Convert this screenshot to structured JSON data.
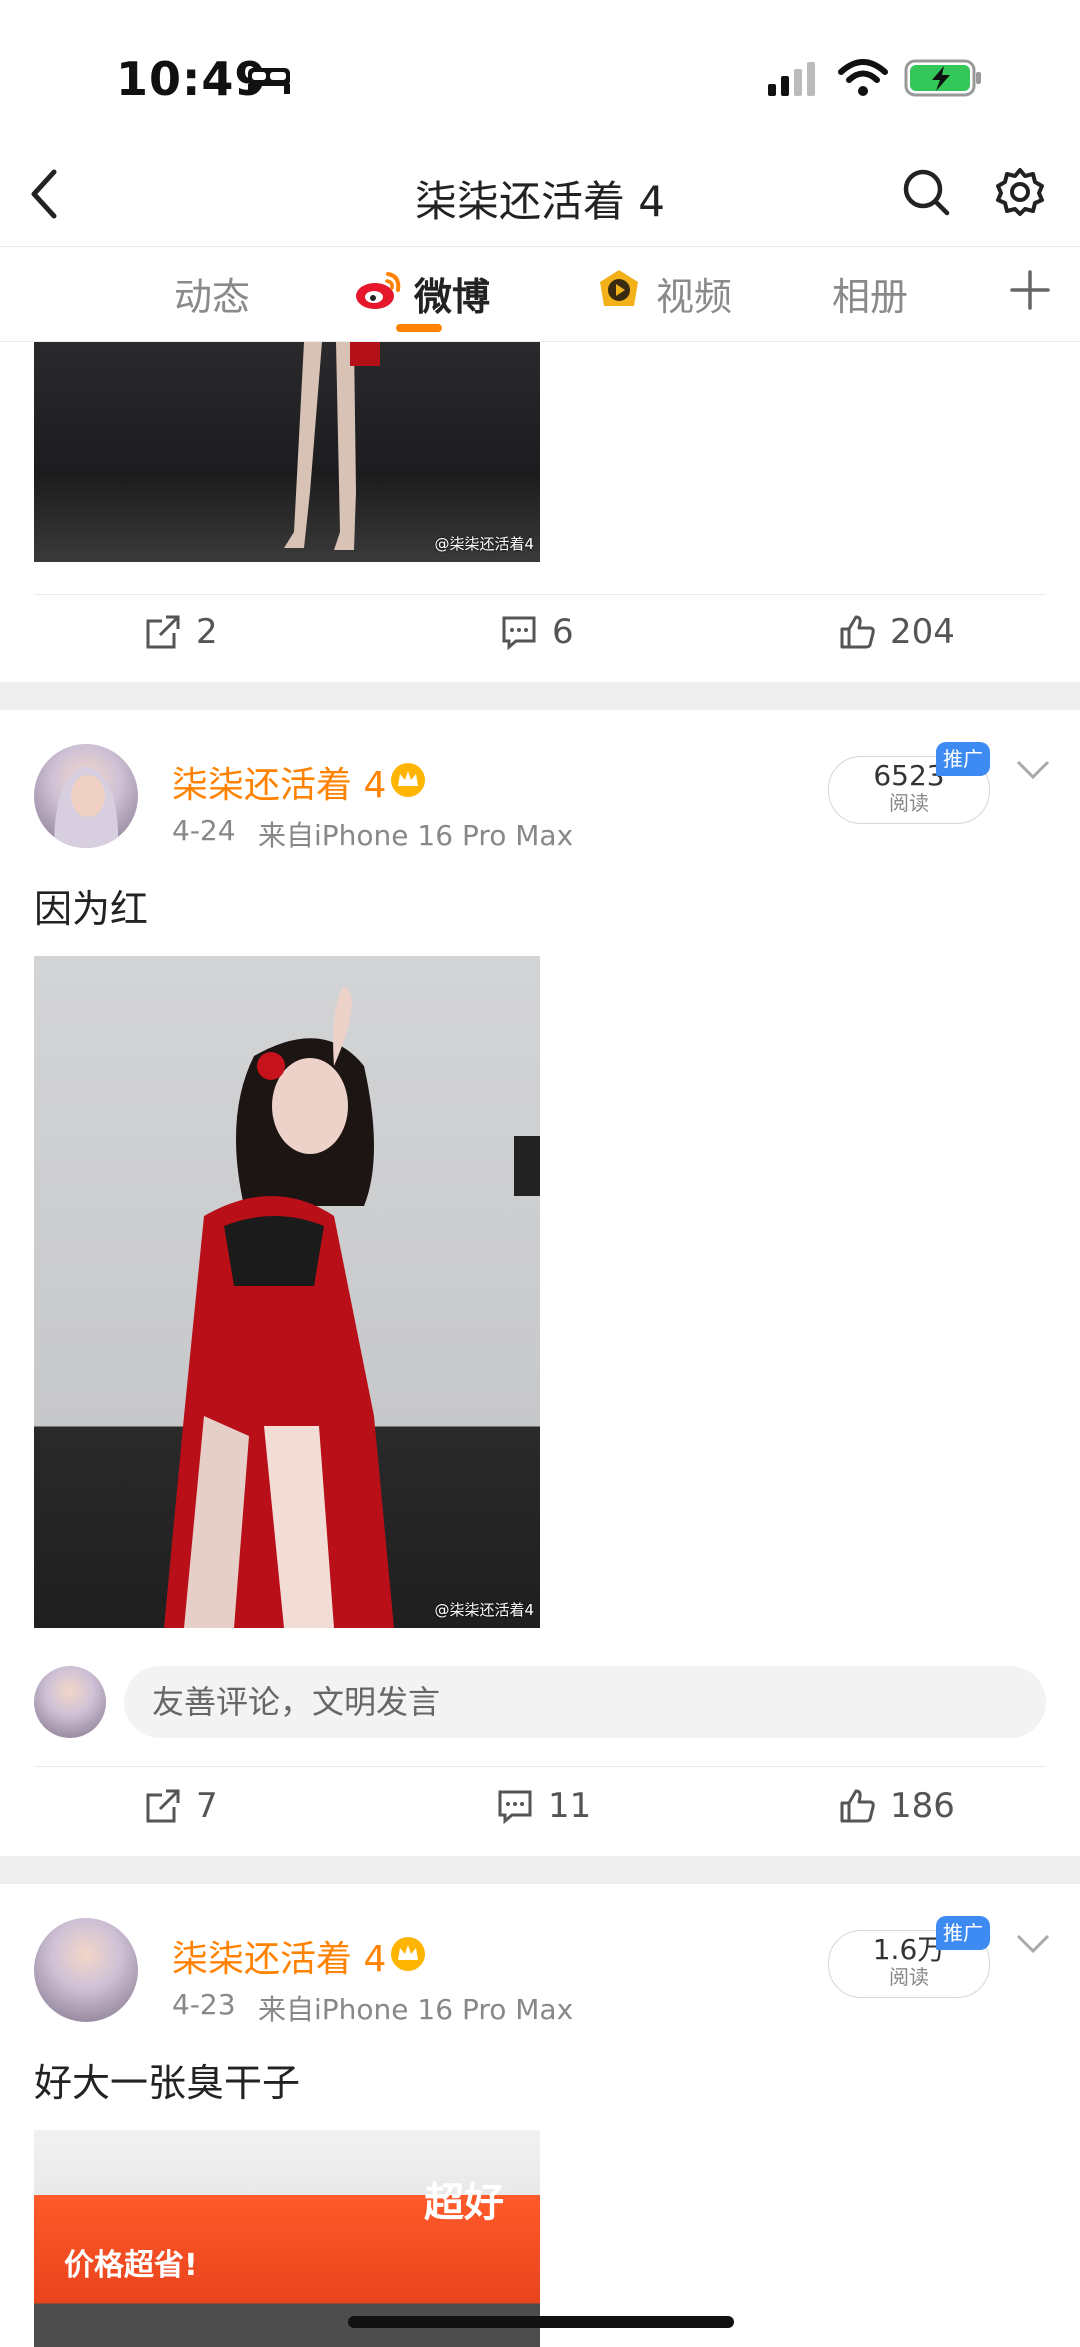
{
  "status_bar": {
    "time": "10:49"
  },
  "nav": {
    "title": "柒柒还活着 4"
  },
  "tabs": [
    {
      "label": "动态"
    },
    {
      "label": "微博"
    },
    {
      "label": "视频"
    },
    {
      "label": "相册"
    }
  ],
  "colors": {
    "accent": "#ff8200",
    "promo": "#3d8bf2"
  },
  "posts": [
    {
      "watermark": "@柒柒还活着4",
      "reposts": "2",
      "comments": "6",
      "likes": "204"
    },
    {
      "username": "柒柒还活着 4",
      "date": "4-24",
      "source": "来自iPhone 16 Pro Max",
      "reads": "6523",
      "reads_label": "阅读",
      "promo": "推广",
      "text": "因为红",
      "watermark": "@柒柒还活着4",
      "comment_placeholder": "友善评论，文明发言",
      "reposts": "7",
      "comments": "11",
      "likes": "186"
    },
    {
      "username": "柒柒还活着 4",
      "date": "4-23",
      "source": "来自iPhone 16 Pro Max",
      "reads": "1.6万",
      "reads_label": "阅读",
      "promo": "推广",
      "text": "好大一张臭干子",
      "sign_text_1": "价格超省!",
      "sign_text_2": "超好"
    }
  ]
}
